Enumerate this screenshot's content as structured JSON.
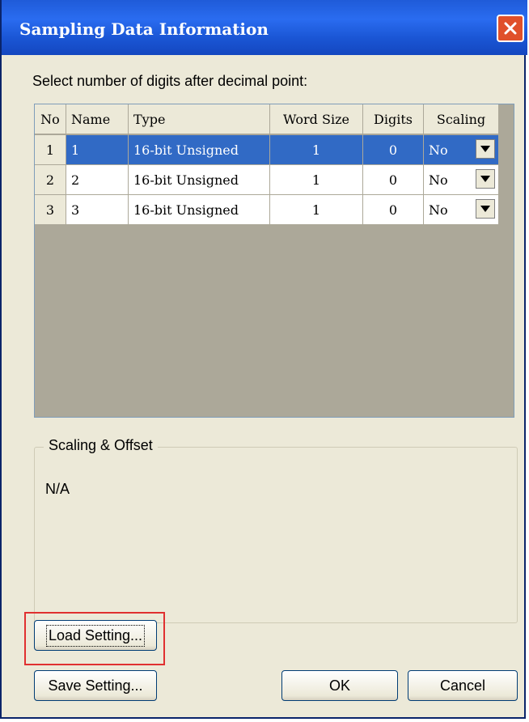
{
  "window": {
    "title": "Sampling Data Information"
  },
  "prompt": "Select number of digits after decimal point:",
  "grid": {
    "columns": [
      "No",
      "Name",
      "Type",
      "Word Size",
      "Digits",
      "Scaling"
    ],
    "rows": [
      {
        "no": "1",
        "name": "1",
        "type": "16-bit Unsigned",
        "word_size": "1",
        "digits": "0",
        "scaling": "No",
        "selected": true
      },
      {
        "no": "2",
        "name": "2",
        "type": "16-bit Unsigned",
        "word_size": "1",
        "digits": "0",
        "scaling": "No",
        "selected": false
      },
      {
        "no": "3",
        "name": "3",
        "type": "16-bit Unsigned",
        "word_size": "1",
        "digits": "0",
        "scaling": "No",
        "selected": false
      }
    ]
  },
  "scaling_group": {
    "legend": "Scaling & Offset",
    "value": "N/A"
  },
  "buttons": {
    "load": "Load Setting...",
    "save": "Save Setting...",
    "ok": "OK",
    "cancel": "Cancel"
  },
  "colors": {
    "title_bar": "#1f5bd8",
    "selection": "#316ac5",
    "highlight": "#e03030"
  },
  "icons": {
    "close": "close-icon",
    "dropdown": "chevron-down-icon"
  }
}
